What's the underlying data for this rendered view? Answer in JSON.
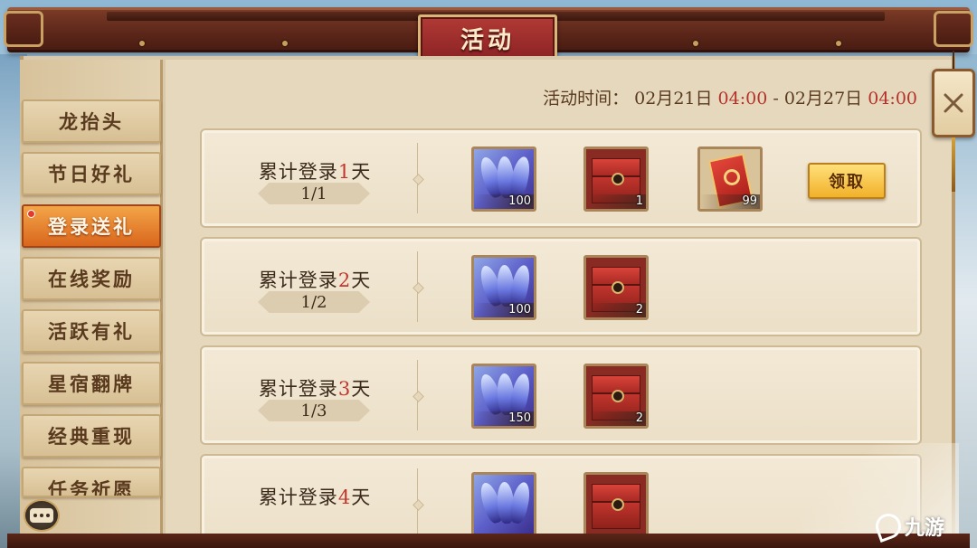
{
  "header": {
    "title": "活动"
  },
  "event_time": {
    "label": "活动时间：",
    "start_date": "02月21日",
    "start_time": "04:00",
    "separator": "-",
    "end_date": "02月27日",
    "end_time": "04:00"
  },
  "sidebar": {
    "items": [
      {
        "label": "龙抬头",
        "active": false
      },
      {
        "label": "节日好礼",
        "active": false
      },
      {
        "label": "登录送礼",
        "active": true
      },
      {
        "label": "在线奖励",
        "active": false
      },
      {
        "label": "活跃有礼",
        "active": false
      },
      {
        "label": "星宿翻牌",
        "active": false
      },
      {
        "label": "经典重现",
        "active": false
      },
      {
        "label": "任务祈愿",
        "active": false
      }
    ]
  },
  "rows": [
    {
      "title_prefix": "累计登录",
      "day": "1",
      "title_suffix": "天",
      "progress": "1/1",
      "rewards": [
        {
          "icon": "feather-icon",
          "count": "100"
        },
        {
          "icon": "chest-icon",
          "count": "1"
        },
        {
          "icon": "ticket-icon",
          "count": "99"
        }
      ],
      "claim_label": "领取"
    },
    {
      "title_prefix": "累计登录",
      "day": "2",
      "title_suffix": "天",
      "progress": "1/2",
      "rewards": [
        {
          "icon": "feather-icon",
          "count": "100"
        },
        {
          "icon": "chest-icon",
          "count": "2"
        }
      ]
    },
    {
      "title_prefix": "累计登录",
      "day": "3",
      "title_suffix": "天",
      "progress": "1/3",
      "rewards": [
        {
          "icon": "feather-icon",
          "count": "150"
        },
        {
          "icon": "chest-icon",
          "count": "2"
        }
      ]
    },
    {
      "title_prefix": "累计登录",
      "day": "4",
      "title_suffix": "天",
      "rewards": [
        {
          "icon": "feather-icon"
        },
        {
          "icon": "chest-icon"
        }
      ]
    }
  ],
  "watermark": {
    "text": "九游"
  },
  "colors": {
    "accent_red": "#b5322b",
    "active_tab": "#e07a25",
    "claim_button": "#f1b12a",
    "title_plaque": "#a32f2e"
  }
}
